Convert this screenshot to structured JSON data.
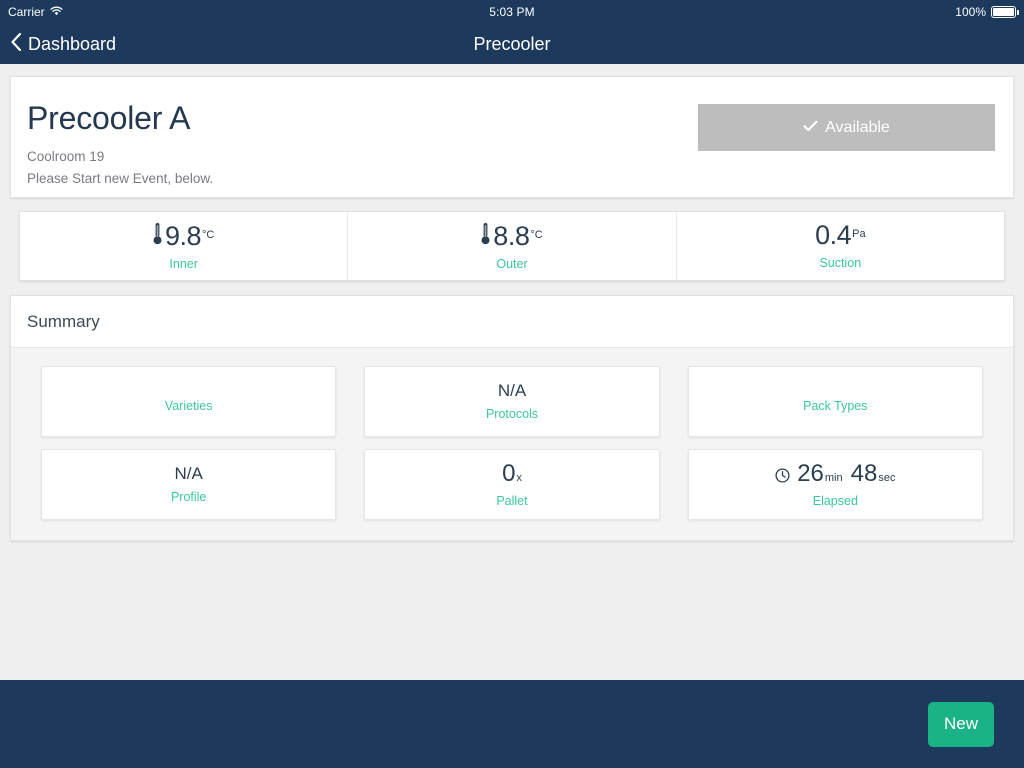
{
  "status_bar": {
    "carrier": "Carrier",
    "wifi_icon": "wifi-icon",
    "time": "5:03 PM",
    "battery_percent": "100%",
    "battery_icon": "battery-icon"
  },
  "nav_bar": {
    "back_icon": "chevron-left-icon",
    "back_label": "Dashboard",
    "title": "Precooler"
  },
  "header": {
    "title": "Precooler A",
    "subtitle_line1": "Coolroom 19",
    "subtitle_line2": "Please Start new Event, below.",
    "status_button": {
      "label": "Available",
      "icon": "check-icon",
      "background": "#bdbdbd"
    }
  },
  "metrics": [
    {
      "icon": "thermometer-icon",
      "value": "9.8",
      "unit": "°C",
      "label": "Inner"
    },
    {
      "icon": "thermometer-icon",
      "value": "8.8",
      "unit": "°C",
      "label": "Outer"
    },
    {
      "icon": "",
      "value": "0.4",
      "unit": "Pa",
      "label": "Suction"
    }
  ],
  "summary": {
    "heading": "Summary",
    "tiles": [
      {
        "value": "",
        "unit": "",
        "label": "Varieties",
        "icon": ""
      },
      {
        "value": "N/A",
        "unit": "",
        "label": "Protocols",
        "icon": ""
      },
      {
        "value": "",
        "unit": "",
        "label": "Pack Types",
        "icon": ""
      },
      {
        "value": "N/A",
        "unit": "",
        "label": "Profile",
        "icon": ""
      },
      {
        "value": "0",
        "unit": "x",
        "label": "Pallet",
        "icon": ""
      }
    ],
    "elapsed_tile": {
      "icon": "clock-icon",
      "minutes": "26",
      "minutes_unit": "min",
      "seconds": "48",
      "seconds_unit": "sec",
      "label": "Elapsed"
    }
  },
  "toolbar": {
    "new_label": "New",
    "new_color": "#1ab385"
  },
  "theme": {
    "navy": "#1d3a5c",
    "accent_green": "#3cc79a",
    "page_bg": "#efeff0",
    "text_dark": "#2b3e50"
  }
}
